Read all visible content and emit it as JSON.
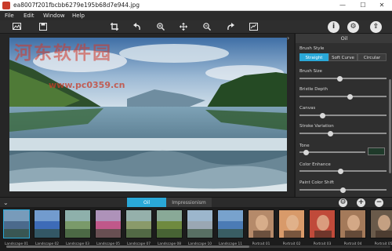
{
  "window": {
    "title": "ea8007f201fbcbb6279e195b68d7e944.jpg",
    "minimize": "—",
    "maximize": "☐",
    "close": "✕"
  },
  "menu": {
    "items": [
      "File",
      "Edit",
      "Window",
      "Help"
    ]
  },
  "toolbar": {
    "left_icons": [
      "image-icon",
      "save-icon",
      "crop-icon",
      "undo-icon",
      "zoom-in-icon",
      "pan-icon",
      "zoom-out-icon",
      "redo-icon",
      "fit-screen-icon"
    ],
    "right_icons": [
      "info-icon",
      "settings-icon",
      "share-icon"
    ]
  },
  "panel": {
    "title": "Oil",
    "brush_style_label": "Brush Style",
    "brush_styles": [
      "Straight",
      "Soft Curve",
      "Circular"
    ],
    "selected_brush_style": "Straight",
    "sliders": [
      {
        "label": "Brush Size",
        "value": 0.46
      },
      {
        "label": "Bristle Depth",
        "value": 0.58
      },
      {
        "label": "Canvas",
        "value": 0.27
      },
      {
        "label": "Stroke Variation",
        "value": 0.36
      },
      {
        "label": "Tone",
        "value": 0.0
      },
      {
        "label": "Color Enhance",
        "value": 0.47
      },
      {
        "label": "Paint Color Shift",
        "value": 0.5
      }
    ],
    "tone_color": "#1f3a2a"
  },
  "strip": {
    "tabs": [
      "Oil",
      "Impressionism"
    ],
    "active_tab": "Oil",
    "thumbnails": [
      {
        "label": "Landscape 01",
        "color": "#4b6a8c"
      },
      {
        "label": "Landscape 02",
        "color": "#3d6bb8"
      },
      {
        "label": "Landscape 03",
        "color": "#7a9a6a"
      },
      {
        "label": "Landscape 05",
        "color": "#c0588a"
      },
      {
        "label": "Landscape 07",
        "color": "#8a9a6a"
      },
      {
        "label": "Landscape 08",
        "color": "#6f8a3f"
      },
      {
        "label": "Landscape 10",
        "color": "#9aa7b3"
      },
      {
        "label": "Landscape 11",
        "color": "#4b7bb5"
      },
      {
        "label": "Portrait 01",
        "color": "#b58a6a"
      },
      {
        "label": "Portrait 02",
        "color": "#d89a6a"
      },
      {
        "label": "Portrait 03",
        "color": "#c04a3a"
      },
      {
        "label": "Portrait 04",
        "color": "#a47a5a"
      },
      {
        "label": "Portrait 05",
        "color": "#6a5a4a"
      }
    ]
  },
  "watermark": {
    "logo": "河东软件园",
    "url": "www.pc0359.cn"
  },
  "colors": {
    "accent": "#2aa8d8"
  }
}
